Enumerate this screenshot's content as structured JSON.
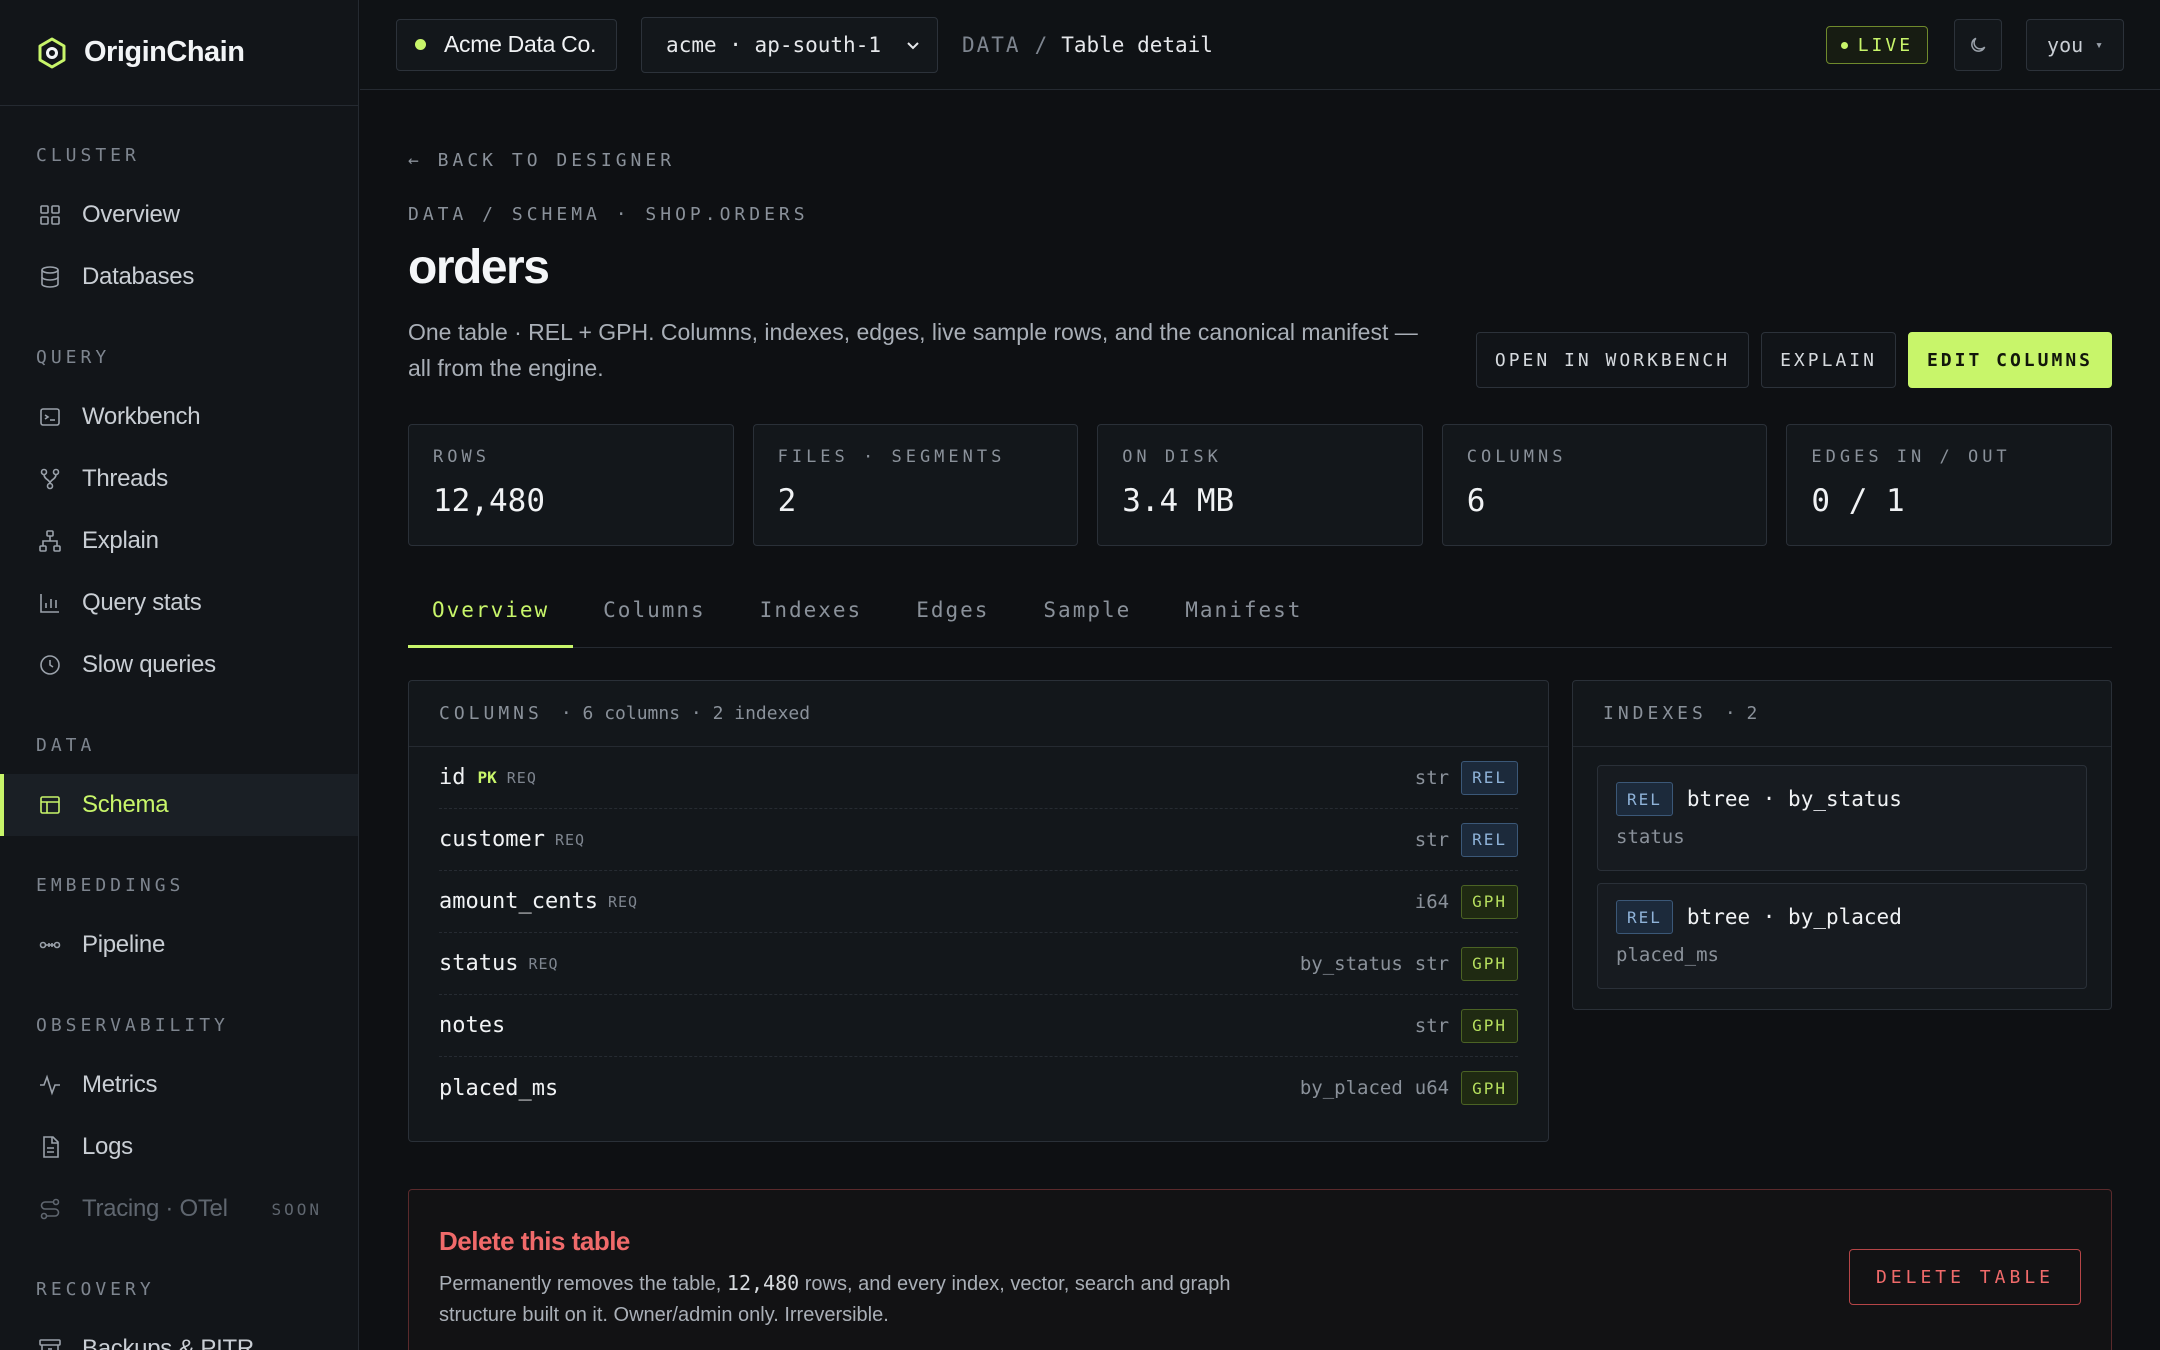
{
  "brand": {
    "name": "OriginChain"
  },
  "sidebar": {
    "sections": [
      {
        "heading": "CLUSTER",
        "items": [
          {
            "label": "Overview",
            "icon": "grid-icon"
          },
          {
            "label": "Databases",
            "icon": "database-icon"
          }
        ]
      },
      {
        "heading": "QUERY",
        "items": [
          {
            "label": "Workbench",
            "icon": "terminal-icon"
          },
          {
            "label": "Threads",
            "icon": "branch-icon"
          },
          {
            "label": "Explain",
            "icon": "tree-icon"
          },
          {
            "label": "Query stats",
            "icon": "bar-chart-icon"
          },
          {
            "label": "Slow queries",
            "icon": "clock-icon"
          }
        ]
      },
      {
        "heading": "DATA",
        "items": [
          {
            "label": "Schema",
            "icon": "table-icon",
            "active": true
          }
        ]
      },
      {
        "heading": "EMBEDDINGS",
        "items": [
          {
            "label": "Pipeline",
            "icon": "pipeline-icon"
          }
        ]
      },
      {
        "heading": "OBSERVABILITY",
        "items": [
          {
            "label": "Metrics",
            "icon": "pulse-icon"
          },
          {
            "label": "Logs",
            "icon": "file-icon"
          },
          {
            "label": "Tracing · OTel",
            "icon": "route-icon",
            "disabled": true,
            "badge": "SOON"
          }
        ]
      },
      {
        "heading": "RECOVERY",
        "items": [
          {
            "label": "Backups & PITR",
            "icon": "archive-icon"
          }
        ]
      }
    ]
  },
  "topbar": {
    "org": "Acme Data Co.",
    "env": "acme · ap-south-1",
    "crumb_section": "DATA",
    "crumb_sep": "/",
    "crumb_page": "Table detail",
    "live": "LIVE",
    "user": "you",
    "user_caret": "▾"
  },
  "page": {
    "back": "← BACK TO DESIGNER",
    "path": "DATA / SCHEMA · SHOP.ORDERS",
    "title": "orders",
    "description": "One table · REL + GPH. Columns, indexes, edges, live sample rows, and the canonical manifest — all from the engine.",
    "actions": {
      "workbench": "OPEN IN WORKBENCH",
      "explain": "EXPLAIN",
      "edit": "EDIT COLUMNS"
    }
  },
  "stats": [
    {
      "label": "ROWS",
      "value": "12,480"
    },
    {
      "label": "FILES · SEGMENTS",
      "value": "2"
    },
    {
      "label": "ON DISK",
      "value": "3.4 MB"
    },
    {
      "label": "COLUMNS",
      "value": "6"
    },
    {
      "label": "EDGES IN / OUT",
      "value": "0 / 1"
    }
  ],
  "tabs": [
    "Overview",
    "Columns",
    "Indexes",
    "Edges",
    "Sample",
    "Manifest"
  ],
  "columns_panel": {
    "title": "COLUMNS",
    "summary": "· 6 columns · 2 indexed",
    "rows": [
      {
        "name": "id",
        "pk": "PK",
        "req": "REQ",
        "index": "",
        "type": "str",
        "tag": "REL"
      },
      {
        "name": "customer",
        "pk": "",
        "req": "REQ",
        "index": "",
        "type": "str",
        "tag": "REL"
      },
      {
        "name": "amount_cents",
        "pk": "",
        "req": "REQ",
        "index": "",
        "type": "i64",
        "tag": "GPH"
      },
      {
        "name": "status",
        "pk": "",
        "req": "REQ",
        "index": "by_status",
        "type": "str",
        "tag": "GPH"
      },
      {
        "name": "notes",
        "pk": "",
        "req": "",
        "index": "",
        "type": "str",
        "tag": "GPH"
      },
      {
        "name": "placed_ms",
        "pk": "",
        "req": "",
        "index": "by_placed",
        "type": "u64",
        "tag": "GPH"
      }
    ]
  },
  "indexes_panel": {
    "title": "INDEXES",
    "summary": "· 2",
    "items": [
      {
        "tag": "REL",
        "name": "btree · by_status",
        "column": "status"
      },
      {
        "tag": "REL",
        "name": "btree · by_placed",
        "column": "placed_ms"
      }
    ]
  },
  "danger": {
    "title": "Delete this table",
    "desc_before": "Permanently removes the table, ",
    "desc_value": "12,480",
    "desc_after": " rows, and every index, vector, search and graph structure built on it. Owner/admin only. Irreversible.",
    "button": "DELETE TABLE"
  }
}
